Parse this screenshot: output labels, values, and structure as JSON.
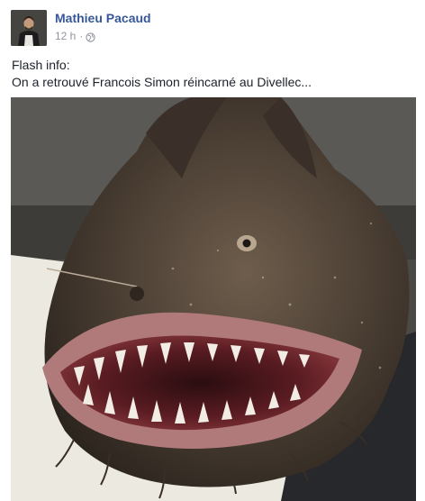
{
  "post": {
    "author": "Mathieu Pacaud",
    "timestamp": "12 h",
    "separator": "·",
    "privacy_icon": "globe-icon",
    "text_lines": [
      "Flash info:",
      "On a retrouvé Francois Simon réincarné au Divellec..."
    ],
    "photo_subject": "anglerfish-photo"
  },
  "colors": {
    "author_link": "#365899",
    "meta_text": "#90949c",
    "body_text": "#1d2129"
  }
}
